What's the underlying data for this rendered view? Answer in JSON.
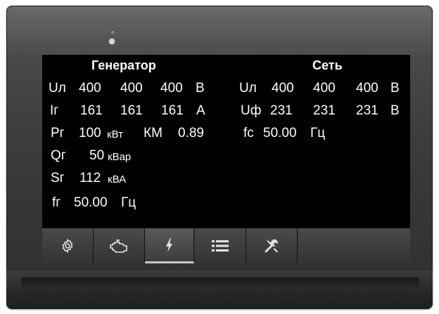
{
  "generator": {
    "title": "Генератор",
    "ul": {
      "label": "Uл",
      "v1": "400",
      "v2": "400",
      "v3": "400",
      "unit": "В"
    },
    "ig": {
      "label": "Iг",
      "v1": "161",
      "v2": "161",
      "v3": "161",
      "unit": "А"
    },
    "pg": {
      "label": "Pг",
      "value": "100",
      "unit": "кВт",
      "km_label": "КМ",
      "km_value": "0.89"
    },
    "qg": {
      "label": "Qг",
      "value": "50",
      "unit": "кВар"
    },
    "sg": {
      "label": "Sг",
      "value": "112",
      "unit": "кВА"
    },
    "fg": {
      "label": "fг",
      "value": "50.00",
      "unit": "Гц"
    }
  },
  "network": {
    "title": "Сеть",
    "ul": {
      "label": "Uл",
      "v1": "400",
      "v2": "400",
      "v3": "400",
      "unit": "В"
    },
    "uf": {
      "label": "Uф",
      "v1": "231",
      "v2": "231",
      "v3": "231",
      "unit": "В"
    },
    "fc": {
      "label": "fc",
      "value": "50.00",
      "unit": "Гц"
    }
  },
  "toolbar": {
    "buttons": [
      {
        "icon": "gear-icon",
        "active": false
      },
      {
        "icon": "engine-icon",
        "active": false
      },
      {
        "icon": "lightning-icon",
        "active": true
      },
      {
        "icon": "list-icon",
        "active": false
      },
      {
        "icon": "tools-icon",
        "active": false
      }
    ]
  },
  "colors": {
    "screen_bg": "#000000",
    "text": "#ffffff",
    "toolbar_bg": "#3a3a3a",
    "bezel": "#3a3a3a"
  }
}
